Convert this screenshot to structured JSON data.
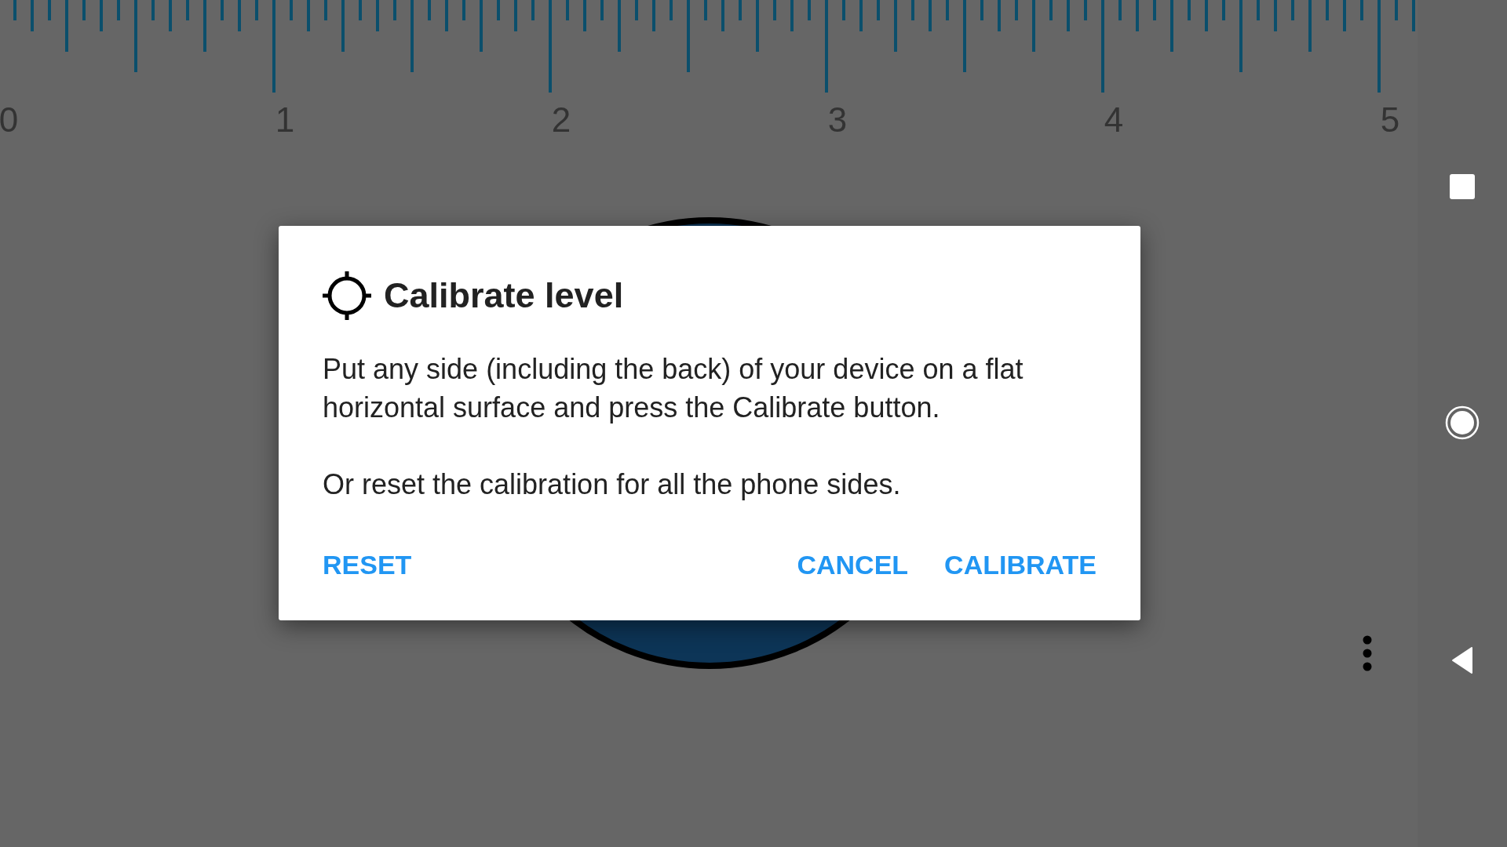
{
  "ruler": {
    "labels": [
      "0",
      "1",
      "2",
      "3",
      "4",
      "5"
    ]
  },
  "dialog": {
    "title": "Calibrate level",
    "paragraphs": [
      "Put any side (including the back) of your device on a flat horizontal surface and press the Calibrate button.",
      "Or reset the calibration for all the phone sides."
    ],
    "neutral_button": "RESET",
    "buttons": [
      "CANCEL",
      "CALIBRATE"
    ]
  }
}
